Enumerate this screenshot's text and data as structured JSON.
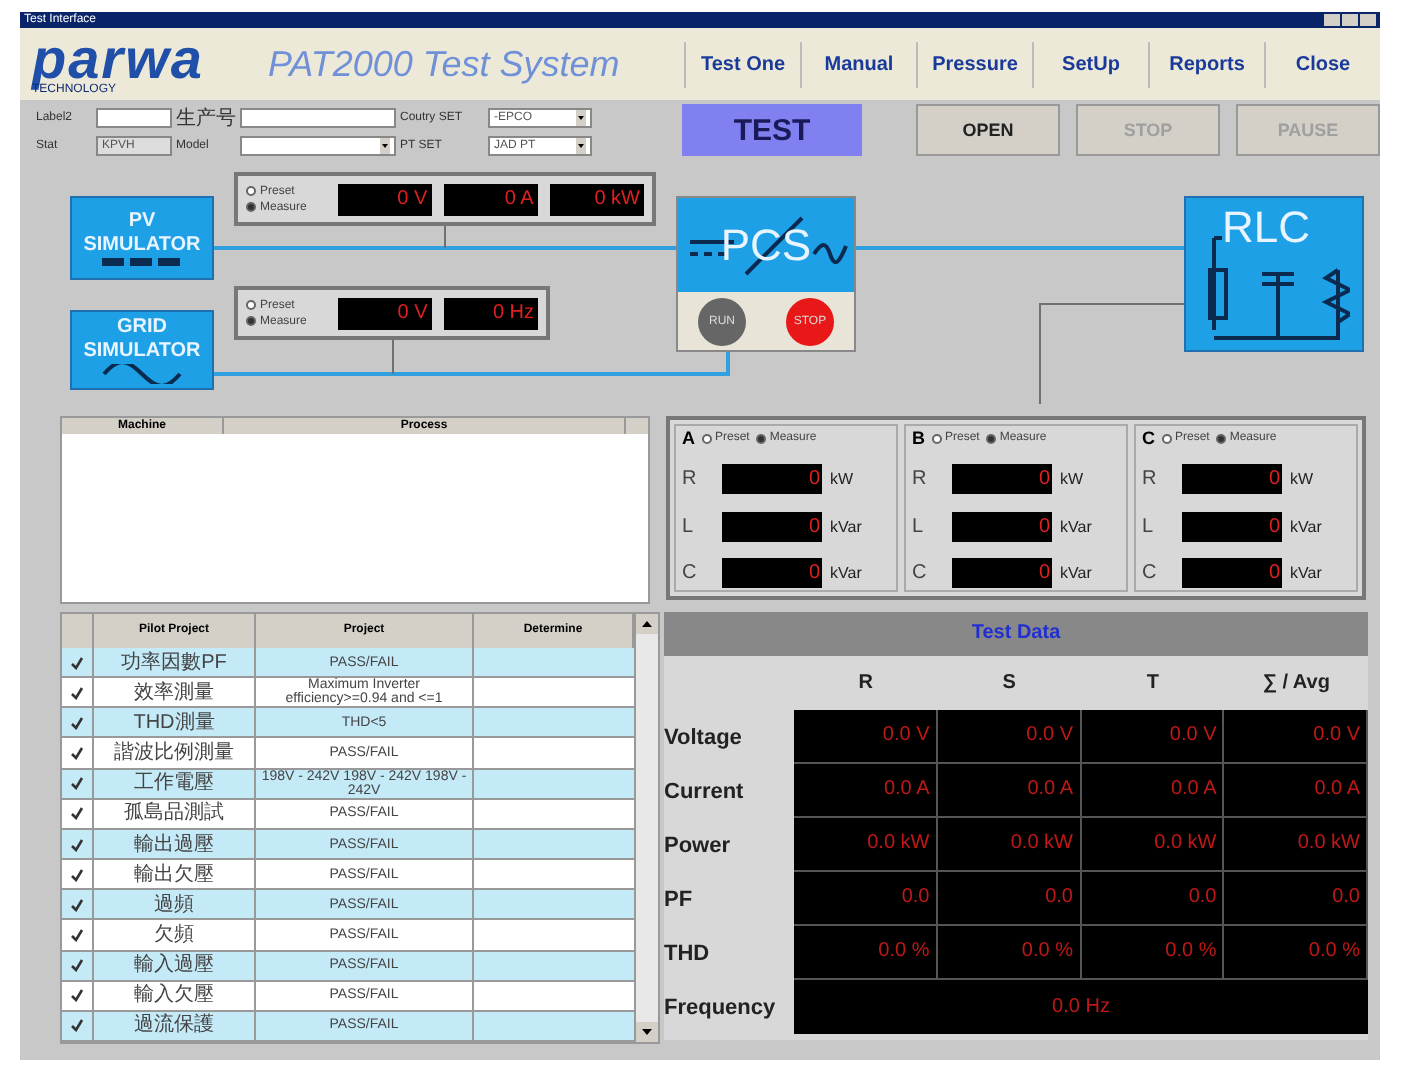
{
  "window": {
    "title": "Test Interface"
  },
  "header": {
    "logo": "parwa",
    "logo_subtitle": "TECHNOLOGY",
    "product": "PAT2000 Test System",
    "menu": [
      "Test One",
      "Manual",
      "Pressure",
      "SetUp",
      "Reports",
      "Close"
    ]
  },
  "form": [
    {
      "label": "Label2",
      "kind": "text",
      "disabled": false
    },
    {
      "label": "生产号",
      "kind": "text",
      "disabled": false
    },
    {
      "label": "Coutry SET",
      "kind": "dropdown",
      "value": "-EPCO",
      "disabled": false
    },
    {
      "label": "Stat",
      "kind": "text",
      "value": "KPVH",
      "disabled": true
    },
    {
      "label": "Model",
      "kind": "dropdown",
      "disabled": false
    },
    {
      "label": "PT SET",
      "kind": "dropdown",
      "value": "JAD PT",
      "disabled": false
    }
  ],
  "actions": [
    {
      "label": "TEST",
      "selected": true,
      "disabled": false
    },
    {
      "label": "OPEN",
      "selected": false,
      "disabled": false
    },
    {
      "label": "STOP",
      "selected": false,
      "disabled": true
    },
    {
      "label": "PAUSE",
      "selected": false,
      "disabled": true
    }
  ],
  "diagram": {
    "pv_simulator": "PV SIMULATOR",
    "pv_readout": {
      "modes": [
        {
          "label": "Preset",
          "selected": false
        },
        {
          "label": "Measure",
          "selected": true
        }
      ],
      "displays": [
        "0 V",
        "0 A",
        "0 kW"
      ]
    },
    "grid_simulator": "GRID SIMULATOR",
    "grid_readout": {
      "modes": [
        {
          "label": "Preset",
          "selected": false
        },
        {
          "label": "Measure",
          "selected": true
        }
      ],
      "displays": [
        "0 V",
        "0 Hz"
      ]
    },
    "pcs": {
      "label": "PCS",
      "buttons": [
        {
          "label": "RUN",
          "kind": "run"
        },
        {
          "label": "STOP",
          "kind": "stop"
        }
      ]
    },
    "rlc": {
      "label": "RLC"
    }
  },
  "process_list": {
    "columns": [
      "Machine",
      "Process"
    ]
  },
  "phases": [
    {
      "name": "A",
      "modes": [
        {
          "label": "Preset",
          "selected": false
        },
        {
          "label": "Measure",
          "selected": true
        }
      ],
      "rows": [
        {
          "label": "R",
          "value": "0",
          "unit": "kW"
        },
        {
          "label": "L",
          "value": "0",
          "unit": "kVar"
        },
        {
          "label": "C",
          "value": "0",
          "unit": "kVar"
        }
      ]
    },
    {
      "name": "B",
      "modes": [
        {
          "label": "Preset",
          "selected": false
        },
        {
          "label": "Measure",
          "selected": true
        }
      ],
      "rows": [
        {
          "label": "R",
          "value": "0",
          "unit": "kW"
        },
        {
          "label": "L",
          "value": "0",
          "unit": "kVar"
        },
        {
          "label": "C",
          "value": "0",
          "unit": "kVar"
        }
      ]
    },
    {
      "name": "C",
      "modes": [
        {
          "label": "Preset",
          "selected": false
        },
        {
          "label": "Measure",
          "selected": true
        }
      ],
      "rows": [
        {
          "label": "R",
          "value": "0",
          "unit": "kW"
        },
        {
          "label": "L",
          "value": "0",
          "unit": "kVar"
        },
        {
          "label": "C",
          "value": "0",
          "unit": "kVar"
        }
      ]
    }
  ],
  "pilot_table": {
    "columns": [
      "Pilot Project",
      "Project",
      "Determine"
    ],
    "rows": [
      {
        "checked": true,
        "pilot": "功率因數PF",
        "project": "PASS/FAIL"
      },
      {
        "checked": true,
        "pilot": "效率測量",
        "project": "Maximum Inverter efficiency>=0.94 and <=1"
      },
      {
        "checked": true,
        "pilot": "THD測量",
        "project": "THD<5"
      },
      {
        "checked": true,
        "pilot": "諧波比例測量",
        "project": "PASS/FAIL"
      },
      {
        "checked": true,
        "pilot": "工作電壓",
        "project": "198V - 242V 198V - 242V 198V - 242V"
      },
      {
        "checked": true,
        "pilot": "孤島品測試",
        "project": "PASS/FAIL"
      },
      {
        "checked": true,
        "pilot": "輸出過壓",
        "project": "PASS/FAIL"
      },
      {
        "checked": true,
        "pilot": "輸出欠壓",
        "project": "PASS/FAIL"
      },
      {
        "checked": true,
        "pilot": "過頻",
        "project": "PASS/FAIL"
      },
      {
        "checked": true,
        "pilot": "欠頻",
        "project": "PASS/FAIL"
      },
      {
        "checked": true,
        "pilot": "輸入過壓",
        "project": "PASS/FAIL"
      },
      {
        "checked": true,
        "pilot": "輸入欠壓",
        "project": "PASS/FAIL"
      },
      {
        "checked": true,
        "pilot": "過流保護",
        "project": "PASS/FAIL"
      }
    ]
  },
  "test_data": {
    "title": "Test Data",
    "columns": [
      "R",
      "S",
      "T",
      "∑ / Avg"
    ],
    "rows": [
      {
        "label": "Voltage",
        "kind": "phases",
        "values": [
          "0.0 V",
          "0.0 V",
          "0.0 V",
          "0.0 V"
        ]
      },
      {
        "label": "Current",
        "kind": "phases",
        "values": [
          "0.0 A",
          "0.0 A",
          "0.0 A",
          "0.0 A"
        ]
      },
      {
        "label": "Power",
        "kind": "phases",
        "values": [
          "0.0 kW",
          "0.0 kW",
          "0.0 kW",
          "0.0 kW"
        ]
      },
      {
        "label": "PF",
        "kind": "phases",
        "values": [
          "0.0",
          "0.0",
          "0.0",
          "0.0"
        ]
      },
      {
        "label": "THD",
        "kind": "phases",
        "values": [
          "0.0 %",
          "0.0 %",
          "0.0 %",
          "0.0 %"
        ]
      },
      {
        "label": "Frequency",
        "kind": "total",
        "value": "0.0 Hz"
      }
    ]
  }
}
